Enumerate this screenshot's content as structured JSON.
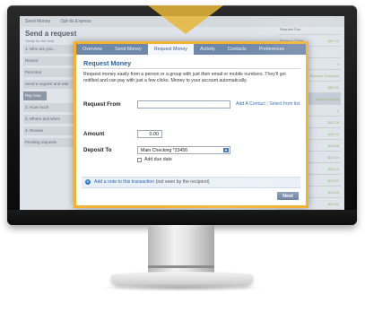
{
  "background_app": {
    "topnav": [
      "Send Money",
      "Opt-Its Express"
    ],
    "title": "Send a request",
    "subtitle": "Today for the Subj",
    "left_blocks": [
      "1. Who are you...",
      "Recent",
      "Personal",
      "Send a request and wait",
      "Pay now",
      "2. How much",
      "3. Where and when",
      "4. Review",
      "Pending requests"
    ],
    "right_rows": [
      {
        "label": "Request Due",
        "value": ""
      },
      {
        "label": "Balance / Date",
        "value": "$82.14"
      },
      {
        "label": "",
        "value": ""
      },
      {
        "label": "",
        "value": "0"
      },
      {
        "label": "",
        "value": "Balance Schedule"
      },
      {
        "label": "",
        "value": "$65.31"
      },
      {
        "label": "",
        "value": "Request Acted"
      },
      {
        "label": "",
        "value": "0"
      },
      {
        "label": "",
        "value": "$52.18"
      },
      {
        "label": "",
        "value": "$38.70"
      },
      {
        "label": "",
        "value": "$33.88"
      },
      {
        "label": "",
        "value": "$31.44"
      },
      {
        "label": "",
        "value": "$28.10"
      },
      {
        "label": "",
        "value": "$26.02"
      },
      {
        "label": "",
        "value": "$24.65"
      },
      {
        "label": "",
        "value": "$20.30"
      }
    ]
  },
  "dialog": {
    "tabs": [
      {
        "label": "Overview",
        "active": false
      },
      {
        "label": "Send Money",
        "active": false
      },
      {
        "label": "Request Money",
        "active": true
      },
      {
        "label": "Activity",
        "active": false
      },
      {
        "label": "Contacts",
        "active": false
      },
      {
        "label": "Preferences",
        "active": false
      }
    ],
    "title": "Request Money",
    "intro": "Request money easily from a person or a group with just their email or mobile numbers. They'll get notified and can pay with just a few clicks. Money to your account automatically.",
    "request_from": {
      "label": "Request From",
      "value": "",
      "placeholder": ""
    },
    "links": {
      "add_contact": "Add A Contact",
      "separator": "|",
      "select_from_list": "Select from list"
    },
    "amount": {
      "label": "Amount",
      "value": "0.00"
    },
    "deposit_to": {
      "label": "Deposit To",
      "selected": "Main Checking *23456"
    },
    "add_due_date": {
      "label": "Add due date",
      "checked": false
    },
    "note": {
      "link": "Add a note to this transaction",
      "rest": " (not seen by the recipient)"
    },
    "next_label": "Next"
  },
  "colors": {
    "accent": "#f2b233",
    "tab_bar": "#7088a8",
    "link": "#2d66b4",
    "title": "#2c5d9b"
  }
}
